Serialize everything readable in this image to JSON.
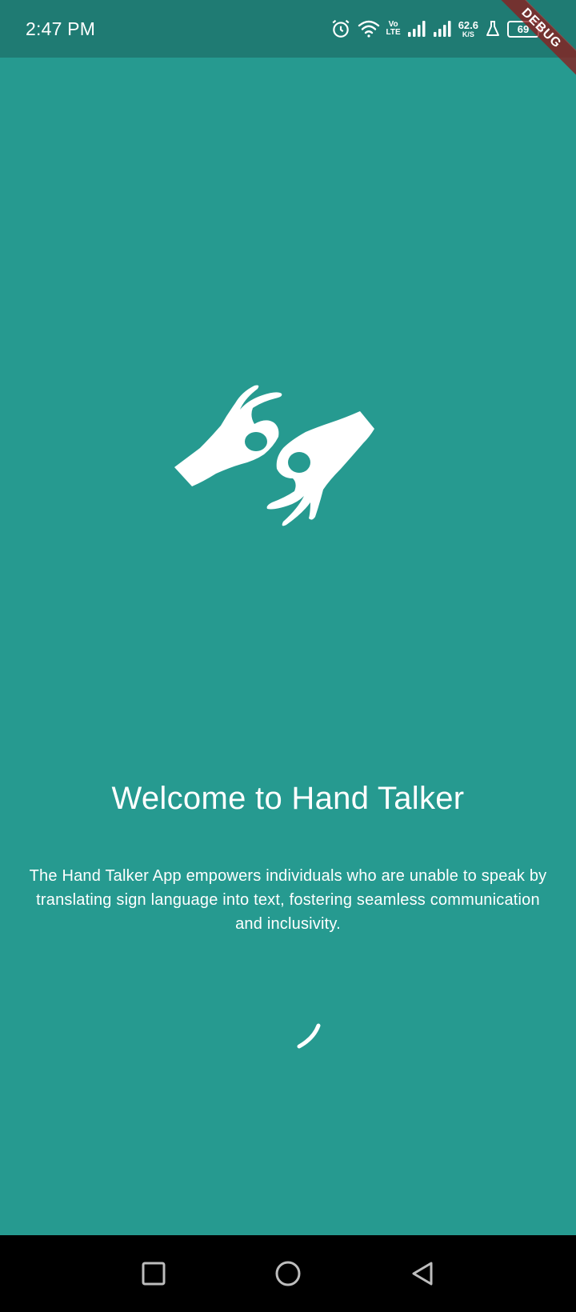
{
  "status_bar": {
    "time": "2:47 PM",
    "volte_top": "Vo",
    "volte_bottom": "LTE",
    "net_speed_value": "62.6",
    "net_speed_unit": "K/S",
    "battery_level": "69",
    "icons": [
      "alarm-icon",
      "wifi-icon",
      "volte-icon",
      "signal-icon",
      "signal-icon",
      "lab-flask-icon",
      "battery-icon"
    ]
  },
  "debug_banner": {
    "label": "DEBUG"
  },
  "welcome": {
    "title": "Welcome to Hand Talker",
    "description": "The Hand Talker App empowers individuals who are unable to speak by translating sign language into text, fostering seamless communication and inclusivity."
  },
  "logo": {
    "icon": "sign-language-hands-icon"
  },
  "loading": {
    "icon": "loading-spinner-icon"
  },
  "nav_bar": {
    "items": [
      "recents-square-icon",
      "home-circle-icon",
      "back-triangle-icon"
    ]
  },
  "colors": {
    "background": "#269a90",
    "status_bar": "#1f7b73",
    "nav_bar": "#000000",
    "text": "#ffffff",
    "debug_banner": "#8c1e1e"
  }
}
